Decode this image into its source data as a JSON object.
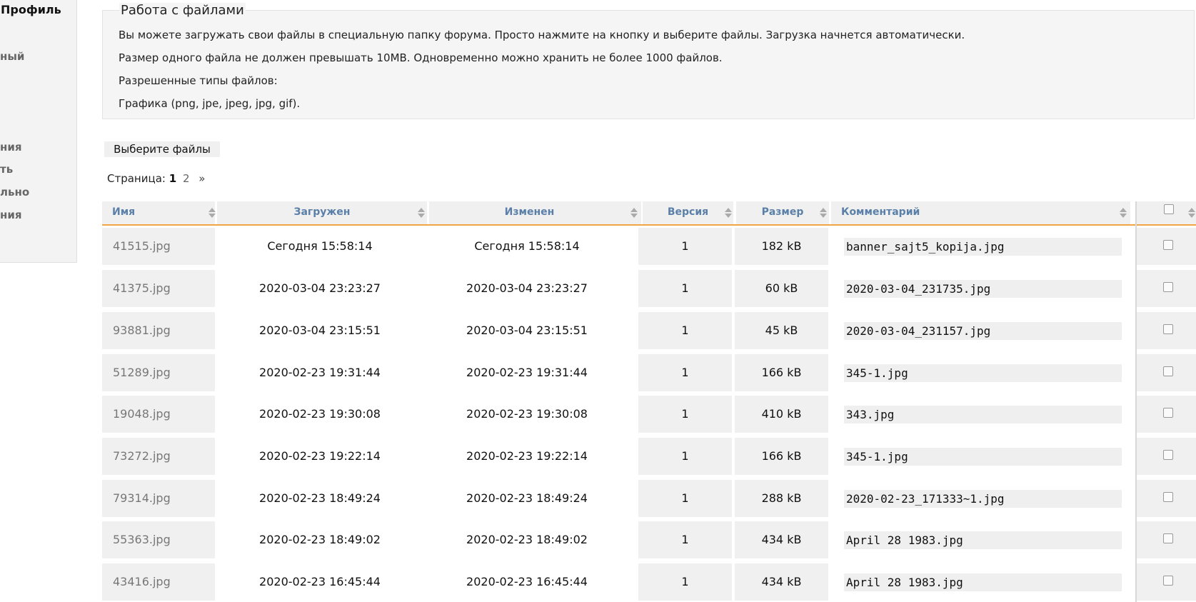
{
  "sidebar": {
    "title": "Профиль",
    "items": [
      "ный",
      "ния",
      "ть",
      "льно",
      "ния"
    ]
  },
  "info": {
    "legend": "Работа с файлами",
    "lines": [
      "Вы можете загружать свои файлы в специальную папку форума. Просто нажмите на кнопку и выберите файлы. Загрузка начнется автоматически.",
      "Размер одного файла не должен превышать 10MB. Одновременно можно хранить не более 1000 файлов.",
      "Разрешенные типы файлов:",
      "Графика (png, jpe, jpeg, jpg, gif)."
    ]
  },
  "upload_button": "Выберите файлы",
  "pager": {
    "label": "Страница:",
    "current": "1",
    "next_page": "2",
    "next_arrow": "»"
  },
  "table": {
    "columns": {
      "name": "Имя",
      "uploaded": "Загружен",
      "modified": "Изменен",
      "version": "Версия",
      "size": "Размер",
      "comment": "Комментарий"
    },
    "rows": [
      {
        "name": "41515.jpg",
        "uploaded": "Сегодня 15:58:14",
        "modified": "Сегодня 15:58:14",
        "version": "1",
        "size": "182 kB",
        "comment": "banner_sajt5_kopija.jpg"
      },
      {
        "name": "41375.jpg",
        "uploaded": "2020-03-04 23:23:27",
        "modified": "2020-03-04 23:23:27",
        "version": "1",
        "size": "60 kB",
        "comment": "2020-03-04_231735.jpg"
      },
      {
        "name": "93881.jpg",
        "uploaded": "2020-03-04 23:15:51",
        "modified": "2020-03-04 23:15:51",
        "version": "1",
        "size": "45 kB",
        "comment": "2020-03-04_231157.jpg"
      },
      {
        "name": "51289.jpg",
        "uploaded": "2020-02-23 19:31:44",
        "modified": "2020-02-23 19:31:44",
        "version": "1",
        "size": "166 kB",
        "comment": "345-1.jpg"
      },
      {
        "name": "19048.jpg",
        "uploaded": "2020-02-23 19:30:08",
        "modified": "2020-02-23 19:30:08",
        "version": "1",
        "size": "410 kB",
        "comment": "343.jpg"
      },
      {
        "name": "73272.jpg",
        "uploaded": "2020-02-23 19:22:14",
        "modified": "2020-02-23 19:22:14",
        "version": "1",
        "size": "166 kB",
        "comment": "345-1.jpg"
      },
      {
        "name": "79314.jpg",
        "uploaded": "2020-02-23 18:49:24",
        "modified": "2020-02-23 18:49:24",
        "version": "1",
        "size": "288 kB",
        "comment": "2020-02-23_171333~1.jpg"
      },
      {
        "name": "55363.jpg",
        "uploaded": "2020-02-23 18:49:02",
        "modified": "2020-02-23 18:49:02",
        "version": "1",
        "size": "434 kB",
        "comment": "April 28 1983.jpg"
      },
      {
        "name": "43416.jpg",
        "uploaded": "2020-02-23 16:45:44",
        "modified": "2020-02-23 16:45:44",
        "version": "1",
        "size": "434 kB",
        "comment": "April 28 1983.jpg"
      }
    ]
  }
}
